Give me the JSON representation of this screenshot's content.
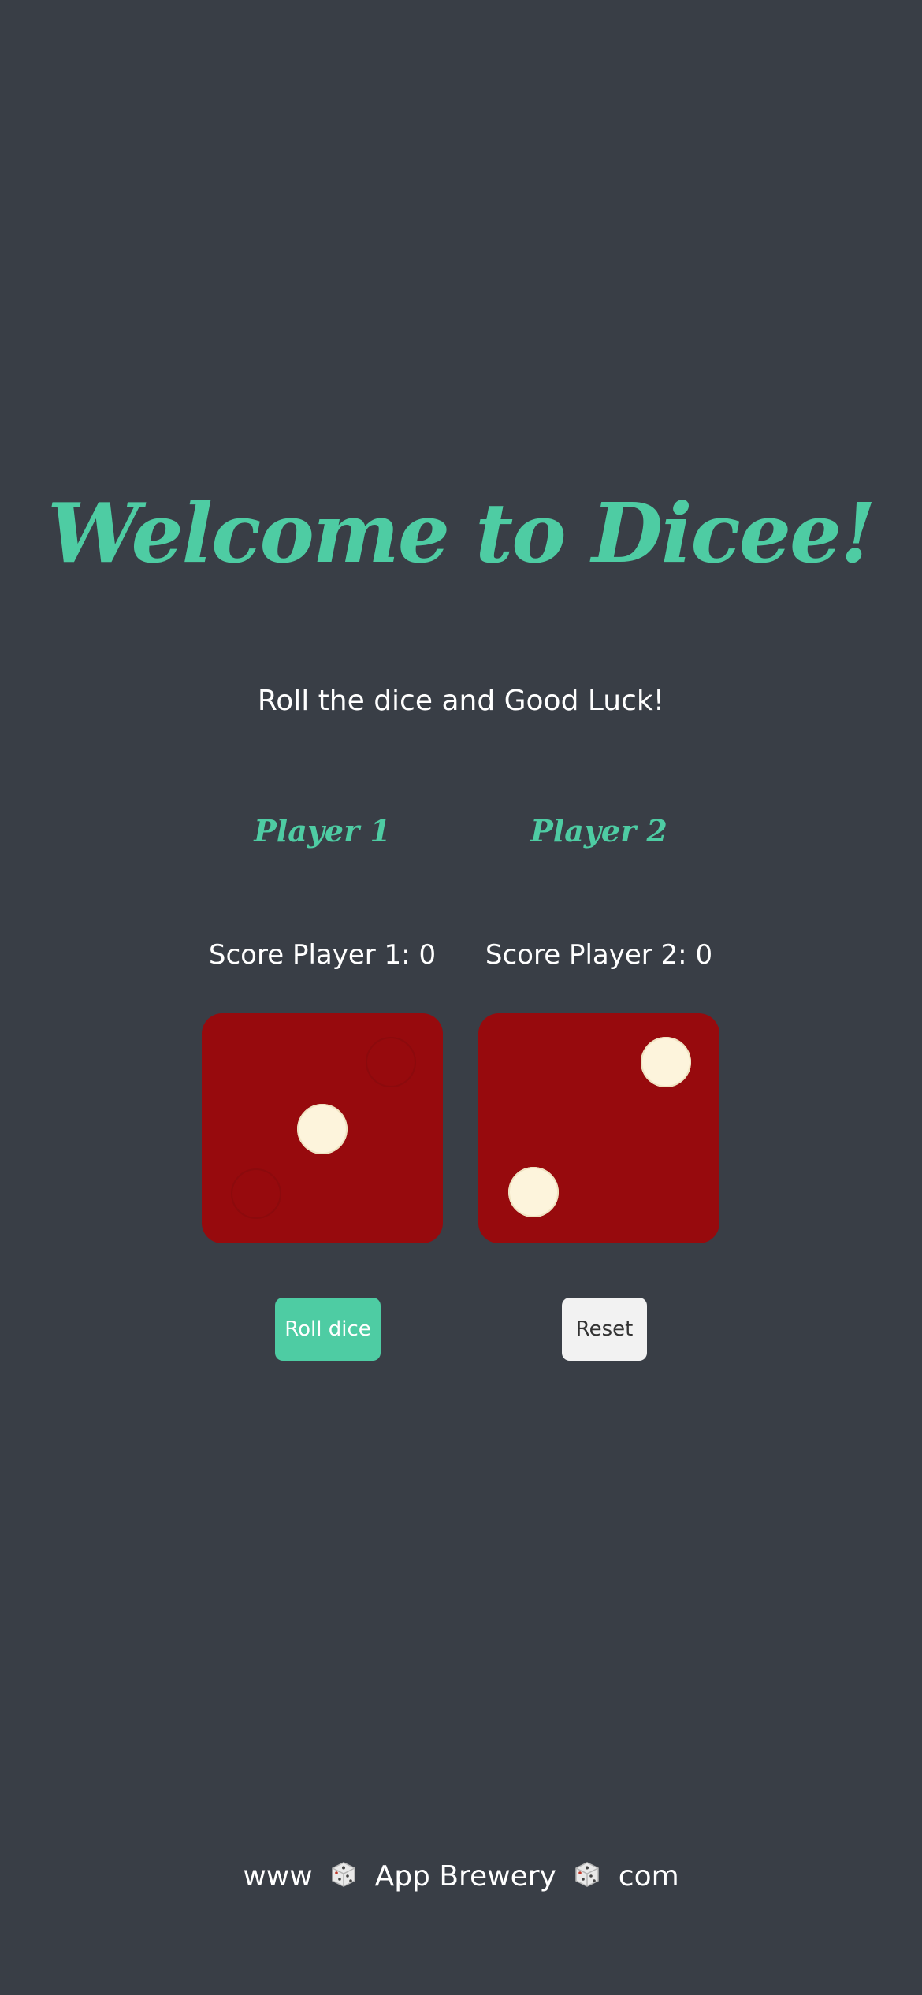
{
  "header": {
    "title": "Welcome to Dicee!",
    "subtitle": "Roll the dice and Good Luck!"
  },
  "players": [
    {
      "name": "Player 1",
      "score_label": "Score Player 1: 0",
      "die_value": 3
    },
    {
      "name": "Player 2",
      "score_label": "Score Player 2: 0",
      "die_value": 2
    }
  ],
  "buttons": {
    "roll_label": "Roll dice",
    "reset_label": "Reset"
  },
  "footer": {
    "prefix": "www",
    "middle": "App Brewery",
    "suffix": "com",
    "icon": "dice-icon"
  },
  "colors": {
    "background": "#393e46",
    "accent": "#4ecca3",
    "die": "#970a0d",
    "pip": "#fdf4dc"
  }
}
